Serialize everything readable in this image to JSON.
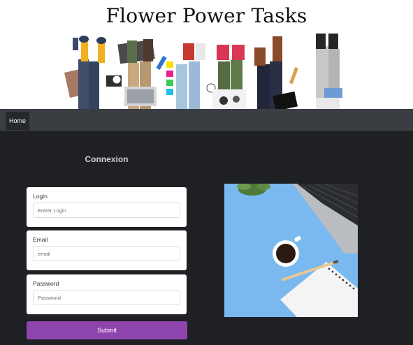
{
  "header": {
    "title": "Flower Power Tasks"
  },
  "nav": {
    "home_label": "Home"
  },
  "form": {
    "heading": "Connexion",
    "fields": [
      {
        "label": "Login",
        "placeholder": "Entrer Login"
      },
      {
        "label": "Email",
        "placeholder": "email"
      },
      {
        "label": "Password",
        "placeholder": "Password"
      }
    ],
    "submit_label": "Submit"
  },
  "colors": {
    "page_background": "#1f2024",
    "navbar": "#3a3d42",
    "submit": "#8e44ad",
    "photo_background": "#79b9ef"
  },
  "images": {
    "banner": "people-lying-with-legs-up-illustration",
    "side": "desk-laptop-coffee-notebook-photo"
  }
}
